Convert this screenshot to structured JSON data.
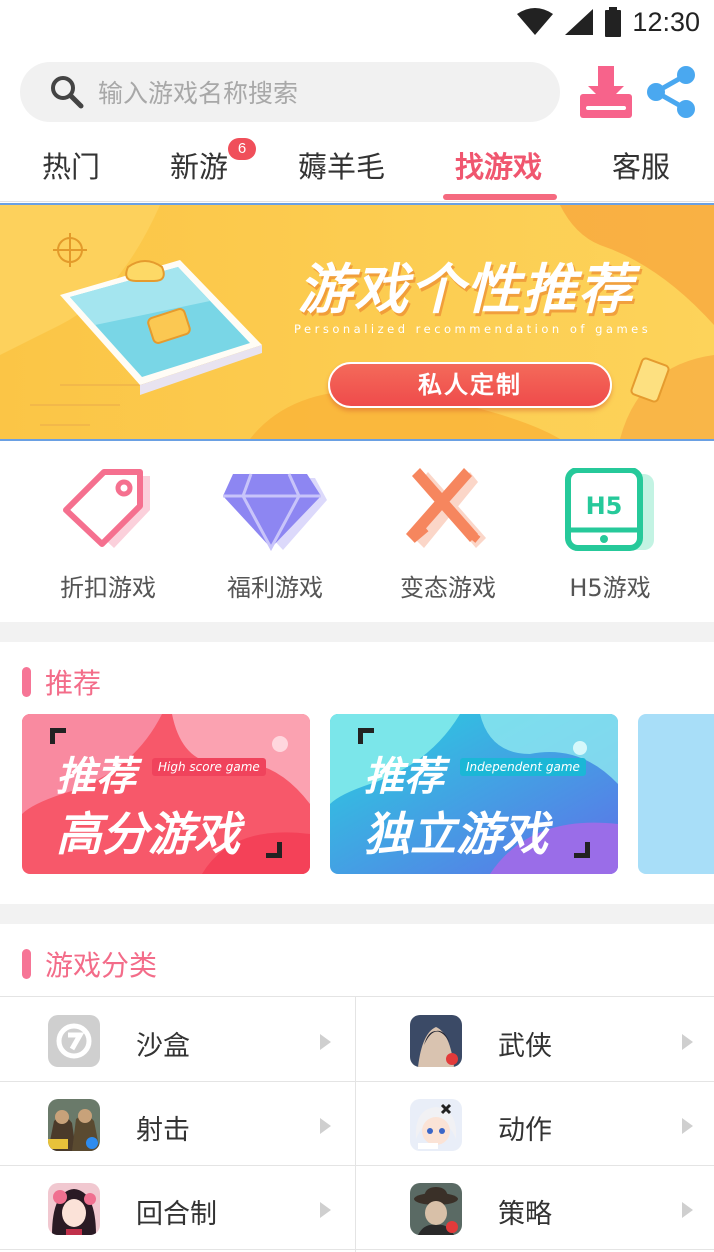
{
  "status_bar": {
    "time": "12:30"
  },
  "search": {
    "placeholder": "输入游戏名称搜索"
  },
  "tabs": [
    {
      "label": "热门"
    },
    {
      "label": "新游",
      "badge": "6"
    },
    {
      "label": "薅羊毛"
    },
    {
      "label": "找游戏",
      "active": true
    },
    {
      "label": "客服"
    }
  ],
  "banner": {
    "title": "游戏个性推荐",
    "subtitle": "Personalized recommendation of games",
    "button": "私人定制"
  },
  "categories": [
    {
      "label": "折扣游戏",
      "icon": "discount-tag-icon"
    },
    {
      "label": "福利游戏",
      "icon": "diamond-icon"
    },
    {
      "label": "变态游戏",
      "icon": "crossed-swords-icon"
    },
    {
      "label": "H5游戏",
      "icon": "h5-tablet-icon"
    }
  ],
  "recommend": {
    "title": "推荐",
    "cards": [
      {
        "line1": "推荐",
        "tag": "High score game",
        "line2": "高分游戏"
      },
      {
        "line1": "推荐",
        "tag": "Independent game",
        "line2": "独立游戏"
      }
    ]
  },
  "game_categories": {
    "title": "游戏分类",
    "items": [
      {
        "name": "沙盒"
      },
      {
        "name": "武侠"
      },
      {
        "name": "射击"
      },
      {
        "name": "动作"
      },
      {
        "name": "回合制"
      },
      {
        "name": "策略"
      }
    ]
  },
  "colors": {
    "accent": "#f0566f",
    "section_mark": "#f67596",
    "badge": "#f04f5a"
  }
}
